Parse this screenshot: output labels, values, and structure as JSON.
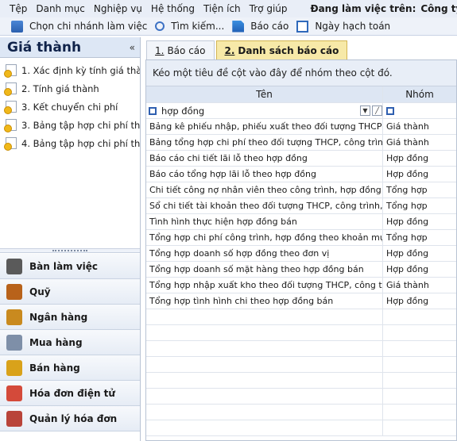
{
  "menu": {
    "items": [
      "Tệp",
      "Danh mục",
      "Nghiệp vụ",
      "Hệ thống",
      "Tiện ích",
      "Trợ giúp"
    ],
    "workspace_label": "Đang làm việc trên:",
    "company": "Công ty Cổ phần"
  },
  "toolbar": {
    "branch": "Chọn chi nhánh làm việc",
    "search": "Tìm kiếm...",
    "report": "Báo cáo",
    "post_date": "Ngày hạch toán"
  },
  "left": {
    "title": "Giá thành",
    "collapse": "«",
    "tree": [
      "1. Xác định kỳ tính giá thành",
      "2. Tính giá thành",
      "3. Kết chuyển chi phí",
      "3. Bảng tập hợp chi phí the...",
      "4. Bảng tập hợp chi phí the..."
    ],
    "modules": [
      {
        "label": "Bàn làm việc",
        "icon": "desk-icon"
      },
      {
        "label": "Quỹ",
        "icon": "fund-icon"
      },
      {
        "label": "Ngân hàng",
        "icon": "bank-icon"
      },
      {
        "label": "Mua hàng",
        "icon": "cart-icon"
      },
      {
        "label": "Bán hàng",
        "icon": "sales-icon"
      },
      {
        "label": "Hóa đơn điện tử",
        "icon": "e-invoice-icon"
      },
      {
        "label": "Quản lý hóa đơn",
        "icon": "invoice-mgmt-icon"
      }
    ]
  },
  "tabs": [
    {
      "num": "1.",
      "label": "Báo cáo"
    },
    {
      "num": "2.",
      "label": "Danh sách báo cáo"
    }
  ],
  "grid": {
    "group_hint": "Kéo một tiêu đề cột vào đây để nhóm theo cột đó.",
    "columns": [
      "Tên",
      "Nhóm"
    ],
    "filter_value": "hợp đồng",
    "rows": [
      {
        "name": "Bảng kê phiếu nhập, phiếu xuất theo đối tượng THCP, c...",
        "group": "Giá thành"
      },
      {
        "name": "Bảng tổng hợp chi phí theo đối tượng THCP, công trình,...",
        "group": "Giá thành"
      },
      {
        "name": "Báo cáo chi tiết lãi lỗ theo hợp đồng",
        "group": "Hợp đồng"
      },
      {
        "name": "Báo cáo tổng hợp lãi lỗ theo hợp đồng",
        "group": "Hợp đồng"
      },
      {
        "name": "Chi tiết công nợ nhân viên theo công trình, hợp đồng",
        "group": "Tổng hợp"
      },
      {
        "name": "Sổ chi tiết tài khoản theo đối tượng THCP, công trình, đơ...",
        "group": "Tổng hợp"
      },
      {
        "name": "Tình hình thực hiện hợp đồng bán",
        "group": "Hợp đồng"
      },
      {
        "name": "Tổng hợp chi phí công trình, hợp đồng theo khoản mục c...",
        "group": "Tổng hợp"
      },
      {
        "name": "Tổng hợp doanh số hợp đồng theo đơn vị",
        "group": "Hợp đồng"
      },
      {
        "name": "Tổng hợp doanh số mặt hàng theo hợp đồng bán",
        "group": "Hợp đồng"
      },
      {
        "name": "Tổng hợp nhập xuất kho theo đối tượng THCP, công trìn...",
        "group": "Giá thành"
      },
      {
        "name": "Tổng hợp tình hình chi theo hợp đồng bán",
        "group": "Hợp đồng"
      }
    ]
  }
}
